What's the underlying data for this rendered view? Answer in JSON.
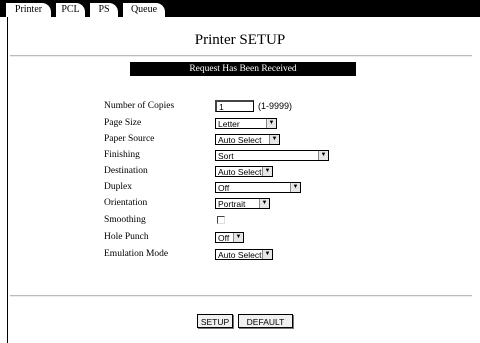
{
  "tabs": [
    {
      "label": "Printer"
    },
    {
      "label": "PCL"
    },
    {
      "label": "PS"
    },
    {
      "label": "Queue"
    }
  ],
  "title": "Printer SETUP",
  "banner": "Request Has Been Received",
  "settings": {
    "copies": {
      "label": "Number of Copies",
      "value": "1",
      "range": "(1-9999)"
    },
    "page_size": {
      "label": "Page Size",
      "value": "Letter"
    },
    "paper_source": {
      "label": "Paper Source",
      "value": "Auto Select"
    },
    "finishing": {
      "label": "Finishing",
      "value": "Sort"
    },
    "destination": {
      "label": "Destination",
      "value": "Auto Select"
    },
    "duplex": {
      "label": "Duplex",
      "value": "Off"
    },
    "orientation": {
      "label": "Orientation",
      "value": "Portrait"
    },
    "smoothing": {
      "label": "Smoothing",
      "checked": false
    },
    "hole_punch": {
      "label": "Hole Punch",
      "value": "Off"
    },
    "emulation_mode": {
      "label": "Emulation Mode",
      "value": "Auto Select"
    }
  },
  "buttons": {
    "setup": "SETUP",
    "default": "DEFAULT"
  }
}
